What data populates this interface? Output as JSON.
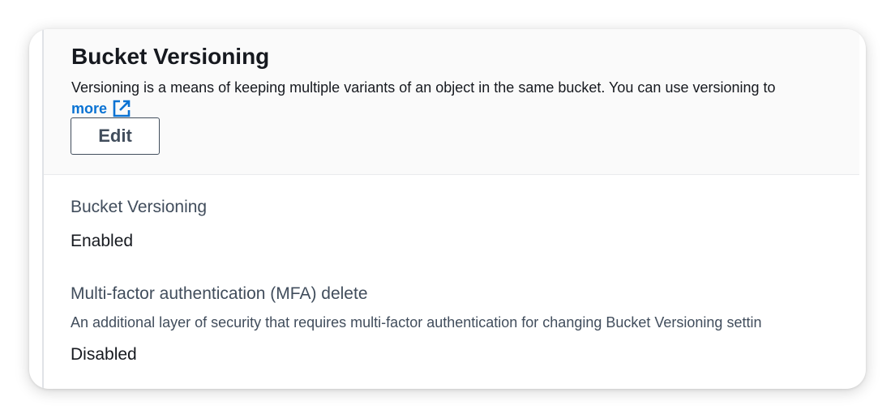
{
  "section": {
    "title": "Bucket Versioning",
    "description": "Versioning is a means of keeping multiple variants of an object in the same bucket. You can use versioning to",
    "learn_more_link": "more",
    "edit_button": "Edit"
  },
  "fields": {
    "versioning": {
      "label": "Bucket Versioning",
      "value": "Enabled"
    },
    "mfa_delete": {
      "label": "Multi-factor authentication (MFA) delete",
      "help": "An additional layer of security that requires multi-factor authentication for changing Bucket Versioning settin",
      "value": "Disabled"
    }
  },
  "icons": {
    "external_link": "external-link-icon"
  },
  "colors": {
    "link": "#0972d3",
    "text": "#16191f",
    "secondary_text": "#414d5c",
    "header_background": "#fafafa"
  }
}
